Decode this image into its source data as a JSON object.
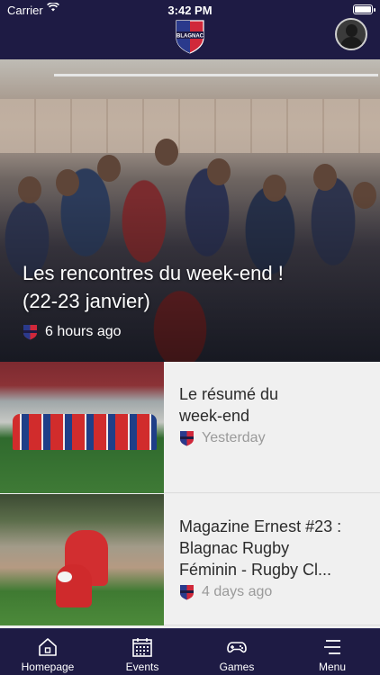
{
  "status_bar": {
    "carrier": "Carrier",
    "time": "3:42 PM"
  },
  "header": {
    "logo_icon": "blagnac-rugby-crest-icon",
    "logo_text": "BLAGNAC",
    "avatar_icon": "user-avatar-icon"
  },
  "colors": {
    "primary": "#1e1b44",
    "list_background": "#f0f0f0",
    "meta_text": "#9a9a9a",
    "crest_red": "#d0283a",
    "crest_blue": "#2a3a8c"
  },
  "hero": {
    "title_line1": "Les rencontres du week-end !",
    "title_line2": "(22-23 janvier)",
    "time": "6 hours ago"
  },
  "articles": [
    {
      "title_line1": "Le résumé du",
      "title_line2": "week-end",
      "time": "Yesterday"
    },
    {
      "title_line1": "Magazine Ernest #23 :",
      "title_line2": "Blagnac Rugby",
      "title_line3": "Féminin - Rugby Cl...",
      "time": "4 days ago"
    }
  ],
  "tabs": [
    {
      "label": "Homepage",
      "icon": "home-icon"
    },
    {
      "label": "Events",
      "icon": "calendar-icon"
    },
    {
      "label": "Games",
      "icon": "gamepad-icon"
    },
    {
      "label": "Menu",
      "icon": "menu-icon"
    }
  ]
}
